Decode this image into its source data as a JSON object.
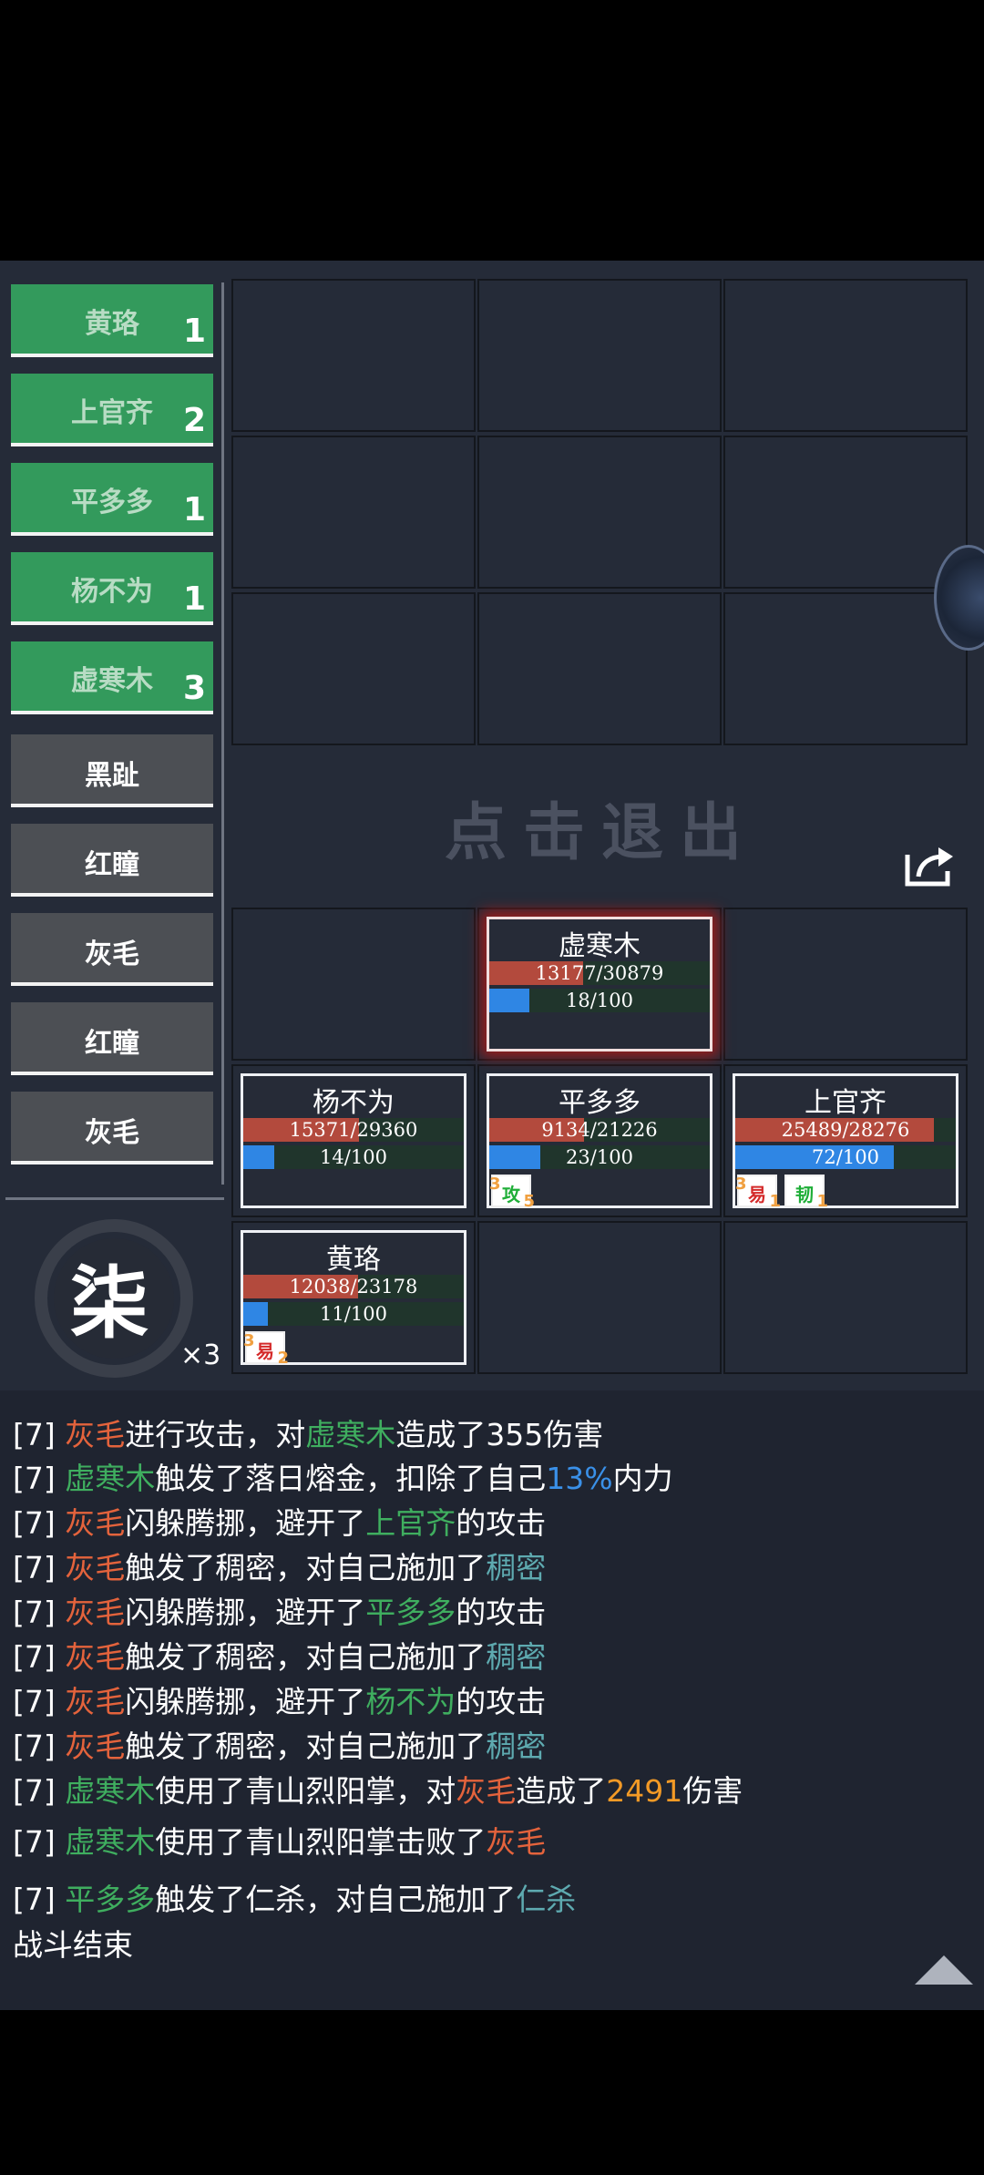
{
  "team": [
    {
      "name": "黄珞",
      "count": "1",
      "side": "ally"
    },
    {
      "name": "上官齐",
      "count": "2",
      "side": "ally"
    },
    {
      "name": "平多多",
      "count": "1",
      "side": "ally"
    },
    {
      "name": "杨不为",
      "count": "1",
      "side": "ally"
    },
    {
      "name": "虚寒木",
      "count": "3",
      "side": "ally"
    },
    {
      "name": "黑趾",
      "count": "",
      "side": "enemy"
    },
    {
      "name": "红瞳",
      "count": "",
      "side": "enemy"
    },
    {
      "name": "灰毛",
      "count": "",
      "side": "enemy"
    },
    {
      "name": "红瞳",
      "count": "",
      "side": "enemy"
    },
    {
      "name": "灰毛",
      "count": "",
      "side": "enemy"
    }
  ],
  "exit_label": "点击退出",
  "units": {
    "xuhanmu": {
      "name": "虚寒木",
      "hp": "13177/30879",
      "hp_frac": 0.427,
      "mp": "18/100",
      "mp_frac": 0.18,
      "active": true,
      "buffs": []
    },
    "yangbuwei": {
      "name": "杨不为",
      "hp": "15371/29360",
      "hp_frac": 0.524,
      "mp": "14/100",
      "mp_frac": 0.14,
      "buffs": []
    },
    "pingduoduo": {
      "name": "平多多",
      "hp": "9134/21226",
      "hp_frac": 0.43,
      "mp": "23/100",
      "mp_frac": 0.23,
      "buffs": [
        {
          "label": "攻",
          "color": "#1fae38",
          "stack": "3",
          "turns": "5"
        }
      ]
    },
    "shangguanqi": {
      "name": "上官齐",
      "hp": "25489/28276",
      "hp_frac": 0.9,
      "mp": "72/100",
      "mp_frac": 0.72,
      "buffs": [
        {
          "label": "易",
          "color": "#d42a2a",
          "stack": "3",
          "turns": "1"
        },
        {
          "label": "韧",
          "color": "#1fae38",
          "stack": "",
          "turns": "1"
        }
      ]
    },
    "huangluo": {
      "name": "黄珞",
      "hp": "12038/23178",
      "hp_frac": 0.52,
      "mp": "11/100",
      "mp_frac": 0.11,
      "buffs": [
        {
          "label": "易",
          "color": "#d42a2a",
          "stack": "3",
          "turns": "2"
        }
      ]
    }
  },
  "portrait": {
    "glyph": "柒",
    "count": "×3"
  },
  "log": [
    [
      {
        "t": "[7] "
      },
      {
        "t": "灰毛",
        "c": "red"
      },
      {
        "t": "进行攻击，对"
      },
      {
        "t": "虚寒木",
        "c": "green"
      },
      {
        "t": "造成了355伤害"
      }
    ],
    [
      {
        "t": "[7] "
      },
      {
        "t": "虚寒木",
        "c": "green"
      },
      {
        "t": "触发了落日熔金，扣除了自己"
      },
      {
        "t": "13%",
        "c": "blue"
      },
      {
        "t": "内力"
      }
    ],
    [
      {
        "t": "[7] "
      },
      {
        "t": "灰毛",
        "c": "red"
      },
      {
        "t": "闪躲腾挪，避开了"
      },
      {
        "t": "上官齐",
        "c": "green"
      },
      {
        "t": "的攻击"
      }
    ],
    [
      {
        "t": "[7] "
      },
      {
        "t": "灰毛",
        "c": "red"
      },
      {
        "t": "触发了稠密，对自己施加了"
      },
      {
        "t": "稠密",
        "c": "teal"
      }
    ],
    [
      {
        "t": "[7] "
      },
      {
        "t": "灰毛",
        "c": "red"
      },
      {
        "t": "闪躲腾挪，避开了"
      },
      {
        "t": "平多多",
        "c": "green"
      },
      {
        "t": "的攻击"
      }
    ],
    [
      {
        "t": "[7] "
      },
      {
        "t": "灰毛",
        "c": "red"
      },
      {
        "t": "触发了稠密，对自己施加了"
      },
      {
        "t": "稠密",
        "c": "teal"
      }
    ],
    [
      {
        "t": "[7] "
      },
      {
        "t": "灰毛",
        "c": "red"
      },
      {
        "t": "闪躲腾挪，避开了"
      },
      {
        "t": "杨不为",
        "c": "green"
      },
      {
        "t": "的攻击"
      }
    ],
    [
      {
        "t": "[7] "
      },
      {
        "t": "灰毛",
        "c": "red"
      },
      {
        "t": "触发了稠密，对自己施加了"
      },
      {
        "t": "稠密",
        "c": "teal"
      }
    ],
    [
      {
        "t": "[7] "
      },
      {
        "t": "虚寒木",
        "c": "green"
      },
      {
        "t": "使用了青山烈阳掌，对"
      },
      {
        "t": "灰毛",
        "c": "red"
      },
      {
        "t": "造成了"
      },
      {
        "t": "2491",
        "c": "orange"
      },
      {
        "t": "伤害"
      }
    ],
    [
      {
        "t": "[7] "
      },
      {
        "t": "虚寒木",
        "c": "green"
      },
      {
        "t": "使用了青山烈阳掌"
      },
      {
        "t": "击败",
        "c": "big"
      },
      {
        "t": "了"
      },
      {
        "t": "灰毛",
        "c": "red"
      }
    ],
    [
      {
        "t": "[7] "
      },
      {
        "t": "平多多",
        "c": "green"
      },
      {
        "t": "触发了仁杀，对自己施加了"
      },
      {
        "t": "仁杀",
        "c": "teal"
      }
    ],
    [
      {
        "t": "战斗结束"
      }
    ]
  ]
}
